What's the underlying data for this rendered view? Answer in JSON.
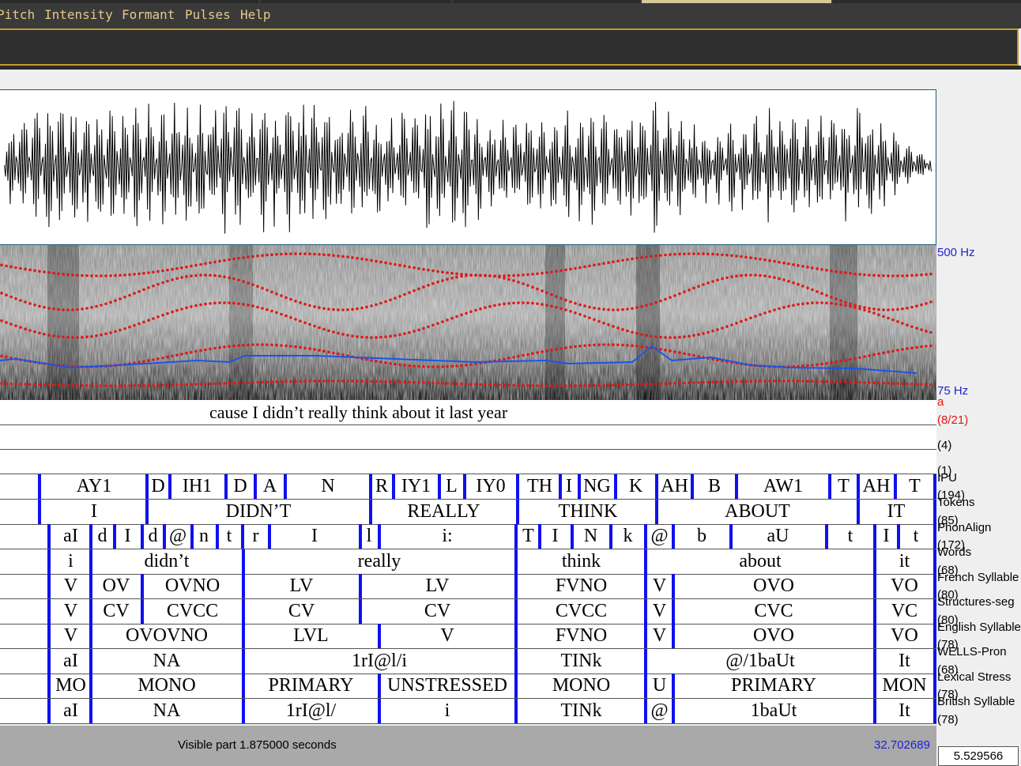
{
  "menu": [
    "Pitch",
    "Intensity",
    "Formant",
    "Pulses",
    "Help"
  ],
  "spectrogram": {
    "freq_top_label": "500 Hz",
    "freq_bottom_label": "75 Hz",
    "pitch_color": "#1a55e8",
    "formant_color": "#e01818"
  },
  "annotation": {
    "label": "a",
    "count": "(8/21)",
    "sentence": "cause I didn’t really think about it last year"
  },
  "tiers": [
    {
      "name": "",
      "count": "(4)",
      "cells": []
    },
    {
      "name": "IPU",
      "count": "(1)",
      "cells": []
    },
    {
      "name": "Tokens",
      "count": "(194)",
      "cells": [
        "AY1",
        "D",
        "IH1",
        "D",
        "A",
        "N",
        "R",
        "IY1",
        "L",
        "IY0",
        "TH",
        "I",
        "NG",
        "K",
        "AH",
        "B",
        "AW1",
        "T",
        "AH",
        "T"
      ]
    },
    {
      "name": "PhonAlign",
      "count": "(85)",
      "cells": [
        "I",
        "DIDN’T",
        "REALLY",
        "THINK",
        "ABOUT",
        "IT"
      ]
    },
    {
      "name": "Words",
      "count": "(172)",
      "cells": [
        "aI",
        "d",
        "I",
        "d",
        "@",
        "n",
        "t",
        "r",
        "I",
        "l",
        "i:",
        "T",
        "I",
        "N",
        "k",
        "@",
        "b",
        "aU",
        "t",
        "I",
        "t"
      ]
    },
    {
      "name": "French Syllable",
      "count": "(68)",
      "cells": [
        "i",
        "didn’t",
        "really",
        "think",
        "about",
        "it"
      ]
    },
    {
      "name": "Structures-seg",
      "count": "(80)",
      "cells": [
        "V",
        "OV",
        "OVNO",
        "LV",
        "LV",
        "FVNO",
        "V",
        "OVO",
        "VO"
      ]
    },
    {
      "name": "English Syllable",
      "count": "(80)",
      "cells": [
        "V",
        "CV",
        "CVCC",
        "CV",
        "CV",
        "CVCC",
        "V",
        "CVC",
        "VC"
      ]
    },
    {
      "name": "WELLS-Pron",
      "count": "(78)",
      "cells": [
        "V",
        "OVOVNO",
        "LVL",
        "V",
        "FVNO",
        "V",
        "OVO",
        "VO"
      ]
    },
    {
      "name": "Lexical Stress",
      "count": "(68)",
      "cells": [
        "aI",
        "NA",
        "1rI@l/i",
        "TINk",
        "@/1baUt",
        "It"
      ]
    },
    {
      "name": "British Syllable",
      "count": "(78)",
      "cells": [
        "MO",
        "MONO",
        "PRIMARY",
        "UNSTRESSED",
        "MONO",
        "U",
        "PRIMARY",
        "MON"
      ]
    },
    {
      "name": "",
      "count": "(78)",
      "cells": [
        "aI",
        "NA",
        "1rI@l/",
        "i",
        "TINk",
        "@",
        "1baUt",
        "It"
      ]
    }
  ],
  "status": {
    "visible_text": "Visible part 1.875000 seconds",
    "end_time": "32.702689",
    "cursor_time": "5.529566"
  }
}
